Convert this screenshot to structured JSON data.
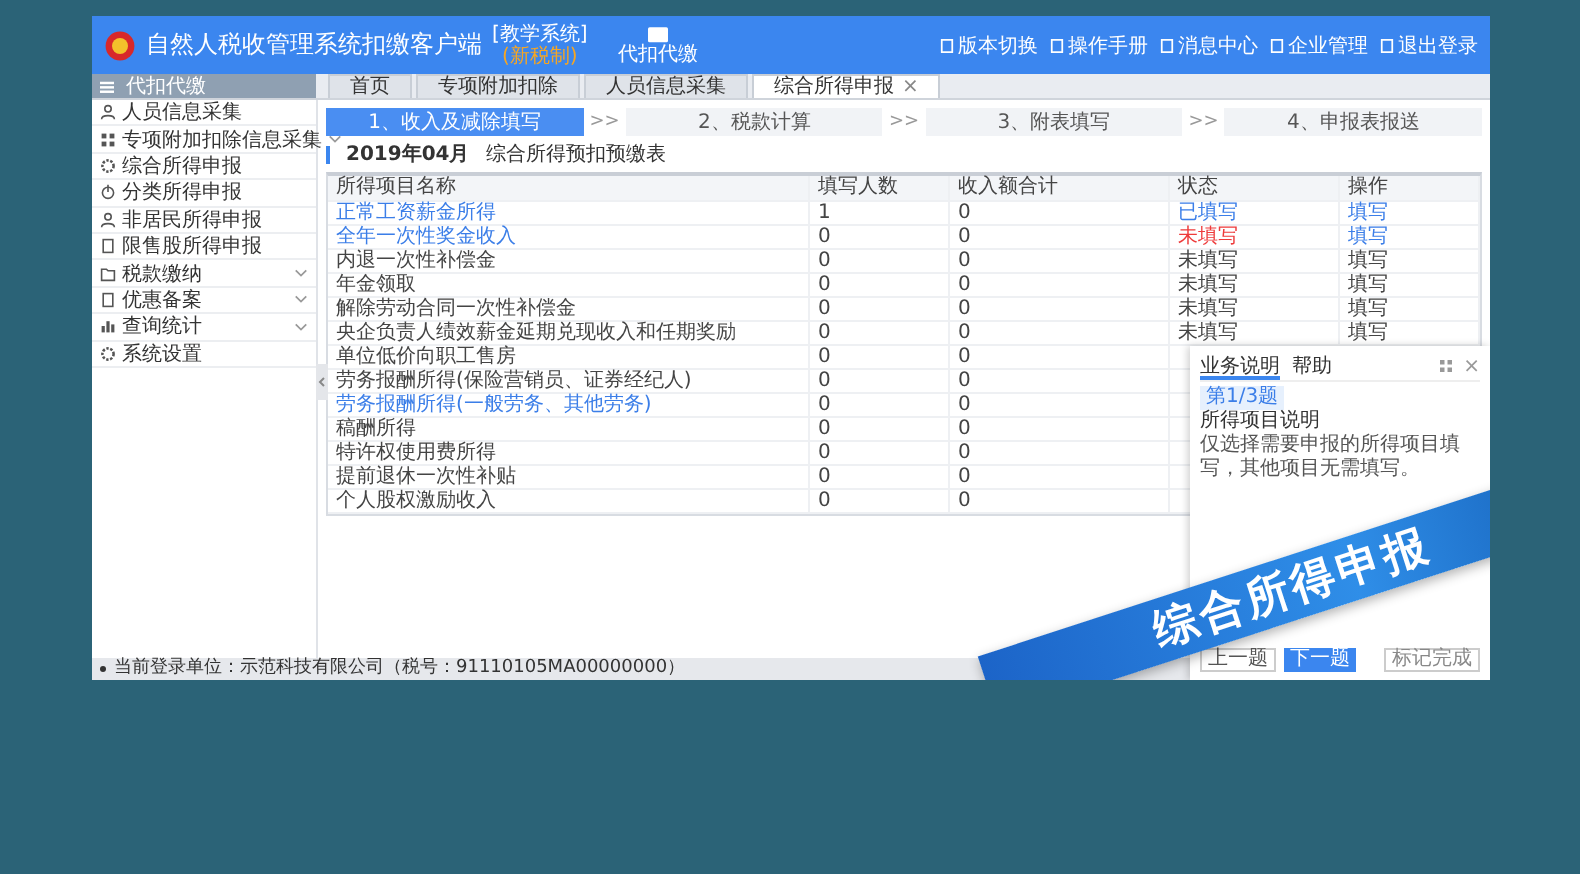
{
  "header": {
    "title": "自然人税收管理系统扣缴客户端",
    "edition": "[教学系统]",
    "tag": "(新税制)",
    "module": "代扣代缴",
    "links": [
      "版本切换",
      "操作手册",
      "消息中心",
      "企业管理",
      "退出登录"
    ]
  },
  "tabs": [
    {
      "label": "首页",
      "selected": false
    },
    {
      "label": "专项附加扣除",
      "selected": false
    },
    {
      "label": "人员信息采集",
      "selected": false
    },
    {
      "label": "综合所得申报",
      "selected": true
    }
  ],
  "tab_close": "×",
  "sidebar": {
    "title": "代扣代缴",
    "items": [
      {
        "label": "人员信息采集",
        "kind": "page"
      },
      {
        "label": "专项附加扣除信息采集",
        "kind": "group"
      },
      {
        "label": "综合所得申报",
        "kind": "page"
      },
      {
        "label": "分类所得申报",
        "kind": "page"
      },
      {
        "label": "非居民所得申报",
        "kind": "page"
      },
      {
        "label": "限售股所得申报",
        "kind": "page"
      },
      {
        "label": "税款缴纳",
        "kind": "group"
      },
      {
        "label": "优惠备案",
        "kind": "group"
      },
      {
        "label": "查询统计",
        "kind": "group"
      },
      {
        "label": "系统设置",
        "kind": "page"
      }
    ]
  },
  "steps": [
    {
      "label": "1、收入及减除填写",
      "selected": true
    },
    {
      "label": "2、税款计算",
      "selected": false
    },
    {
      "label": "3、附表填写",
      "selected": false
    },
    {
      "label": "4、申报表报送",
      "selected": false
    }
  ],
  "step_separator": ">>",
  "report": {
    "period": "2019年04月",
    "title": "综合所得预扣预缴表"
  },
  "table": {
    "columns": [
      "所得项目名称",
      "填写人数",
      "收入额合计",
      "状态",
      "操作"
    ],
    "rows": [
      {
        "name": "正常工资薪金所得",
        "link": true,
        "count": "1",
        "income": "0",
        "status": {
          "text": "已填写",
          "color": "#3b7ee8"
        },
        "action": {
          "text": "填写",
          "link": true
        }
      },
      {
        "name": "全年一次性奖金收入",
        "link": true,
        "count": "0",
        "income": "0",
        "status": {
          "text": "未填写",
          "color": "#ee3b3b"
        },
        "action": {
          "text": "填写",
          "link": true
        }
      },
      {
        "name": "内退一次性补偿金",
        "link": false,
        "count": "0",
        "income": "0",
        "status": {
          "text": "未填写",
          "color": "#444444"
        },
        "action": {
          "text": "填写",
          "link": false
        }
      },
      {
        "name": "年金领取",
        "link": false,
        "count": "0",
        "income": "0",
        "status": {
          "text": "未填写",
          "color": "#444444"
        },
        "action": {
          "text": "填写",
          "link": false
        }
      },
      {
        "name": "解除劳动合同一次性补偿金",
        "link": false,
        "count": "0",
        "income": "0",
        "status": {
          "text": "未填写",
          "color": "#444444"
        },
        "action": {
          "text": "填写",
          "link": false
        }
      },
      {
        "name": "央企负责人绩效薪金延期兑现收入和任期奖励",
        "link": false,
        "count": "0",
        "income": "0",
        "status": {
          "text": "未填写",
          "color": "#444444"
        },
        "action": {
          "text": "填写",
          "link": false
        }
      },
      {
        "name": "单位低价向职工售房",
        "link": false,
        "count": "0",
        "income": "0"
      },
      {
        "name": "劳务报酬所得(保险营销员、证券经纪人)",
        "link": false,
        "count": "0",
        "income": "0"
      },
      {
        "name": "劳务报酬所得(一般劳务、其他劳务)",
        "link": true,
        "count": "0",
        "income": "0"
      },
      {
        "name": "稿酬所得",
        "link": false,
        "count": "0",
        "income": "0"
      },
      {
        "name": "特许权使用费所得",
        "link": false,
        "count": "0",
        "income": "0"
      },
      {
        "name": "提前退休一次性补贴",
        "link": false,
        "count": "0",
        "income": "0"
      },
      {
        "name": "个人股权激励收入",
        "link": false,
        "count": "0",
        "income": "0"
      }
    ]
  },
  "help_panel": {
    "tabs": [
      {
        "label": "业务说明",
        "selected": true
      },
      {
        "label": "帮助",
        "selected": false
      }
    ],
    "close": "×",
    "badge": "第1/3题",
    "heading": "所得项目说明",
    "text": "仅选择需要申报的所得项目填写，其他项目无需填写。",
    "buttons": [
      {
        "label": "上一题",
        "kind": "plain"
      },
      {
        "label": "下一题",
        "kind": "primary"
      },
      {
        "label": "标记完成",
        "kind": "check"
      }
    ]
  },
  "status_bar": "当前登录单位：示范科技有限公司（税号：91110105MA00000000）",
  "ribbon": "综合所得申报"
}
